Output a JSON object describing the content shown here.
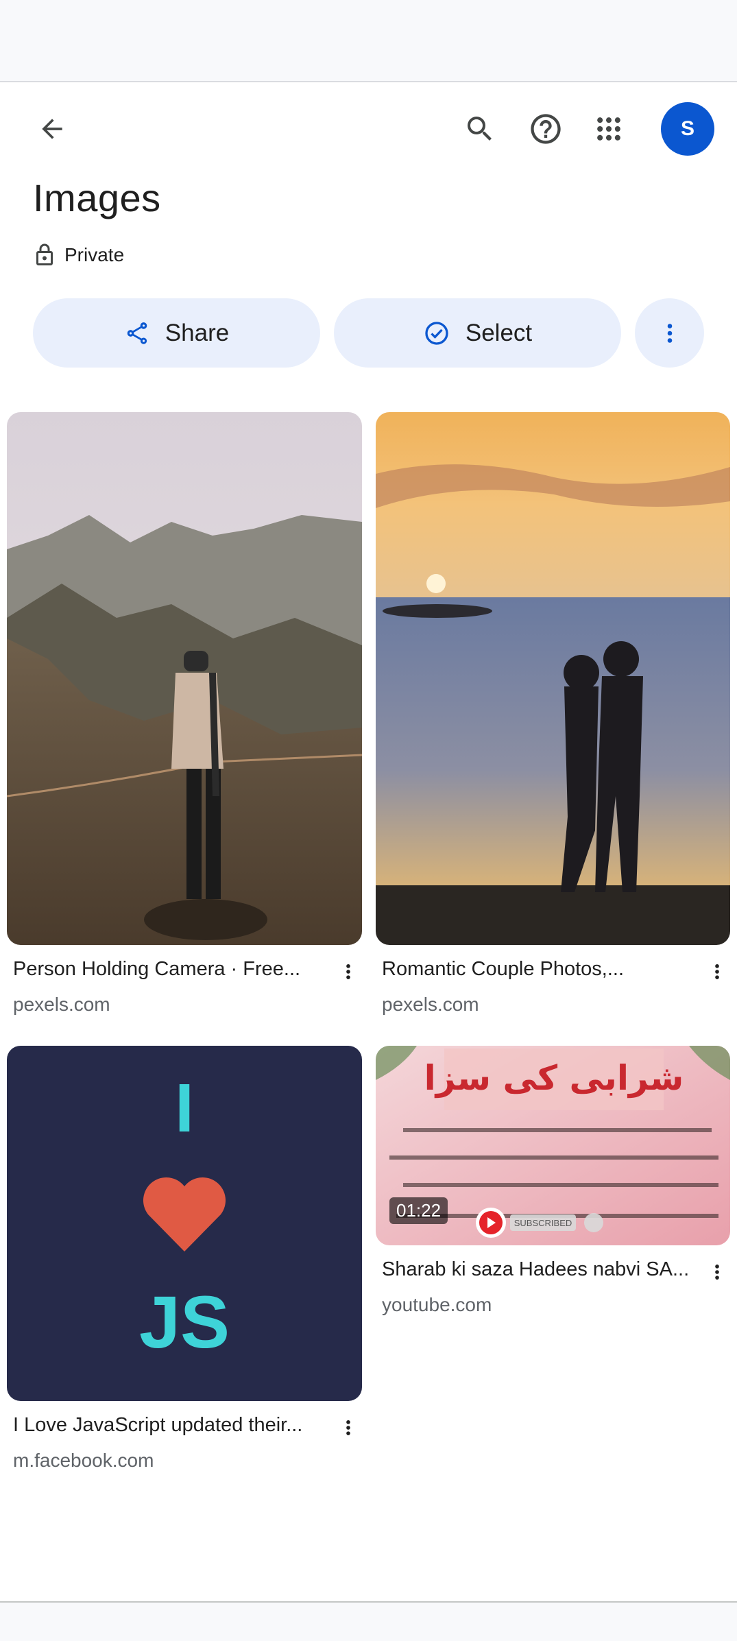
{
  "header": {
    "title": "Images",
    "privacy_label": "Private",
    "avatar_letter": "S"
  },
  "actions": {
    "share_label": "Share",
    "select_label": "Select"
  },
  "icons": {
    "back": "arrow-back-icon",
    "search": "search-icon",
    "help": "help-icon",
    "apps": "apps-grid-icon",
    "lock": "lock-icon",
    "share": "share-icon",
    "select": "check-circle-icon",
    "more": "more-vert-icon"
  },
  "colors": {
    "accent": "#0b57d0",
    "pill_bg": "#e9effc",
    "text_primary": "#1f1f1f",
    "text_secondary": "#5f6368"
  },
  "results": [
    {
      "title": "Person Holding Camera · Free...",
      "source": "pexels.com"
    },
    {
      "title": "Romantic Couple Photos,...",
      "source": "pexels.com"
    },
    {
      "title": "I Love JavaScript updated their...",
      "source": "m.facebook.com",
      "image_text_top": "I",
      "image_text_bottom": "JS"
    },
    {
      "title": "Sharab ki saza Hadees nabvi SA...",
      "source": "youtube.com",
      "duration": "01:22",
      "image_text": "شرابی کی سزا",
      "badge_label": "SUBSCRIBED"
    }
  ]
}
